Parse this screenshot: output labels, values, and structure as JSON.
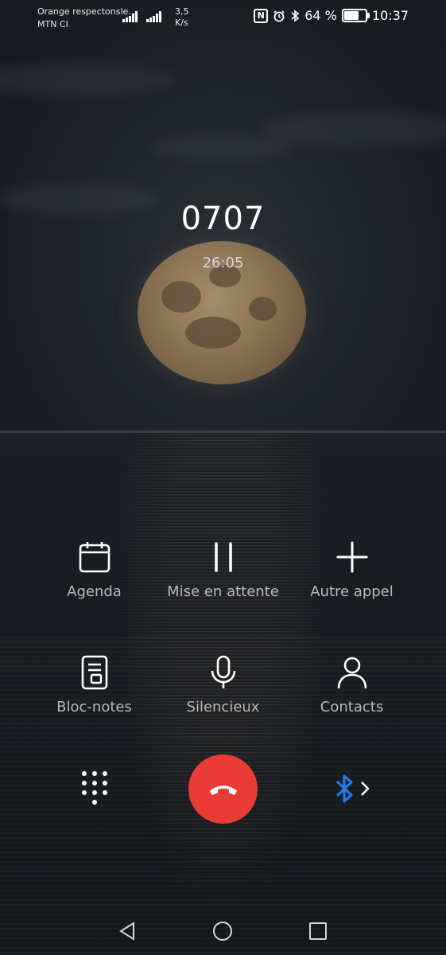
{
  "status_bar": {
    "carrier_primary": "Orange respectonsle...",
    "carrier_secondary": "MTN CI",
    "network_speed_value": "3,5",
    "network_speed_unit": "K/s",
    "battery_percent_text": "64 %",
    "battery_level": 0.64,
    "time": "10:37",
    "icons": [
      "signal-h-icon",
      "signal-e-icon",
      "nfc-icon",
      "alarm-icon",
      "bluetooth-icon",
      "battery-icon"
    ]
  },
  "call": {
    "number": "0707",
    "duration": "26:05"
  },
  "actions": [
    {
      "icon": "calendar-icon",
      "label": "Agenda"
    },
    {
      "icon": "pause-icon",
      "label": "Mise en attente"
    },
    {
      "icon": "plus-icon",
      "label": "Autre appel"
    },
    {
      "icon": "notepad-icon",
      "label": "Bloc-notes"
    },
    {
      "icon": "microphone-icon",
      "label": "Silencieux"
    },
    {
      "icon": "contact-icon",
      "label": "Contacts"
    }
  ],
  "controls": {
    "dialpad_icon": "dialpad-icon",
    "end_call_icon": "end-call-icon",
    "end_call_color": "#ea3c36",
    "audio_route_icon": "bluetooth-icon",
    "audio_route_color": "#1f7be8"
  },
  "nav": [
    "back-icon",
    "home-icon",
    "recents-icon"
  ]
}
